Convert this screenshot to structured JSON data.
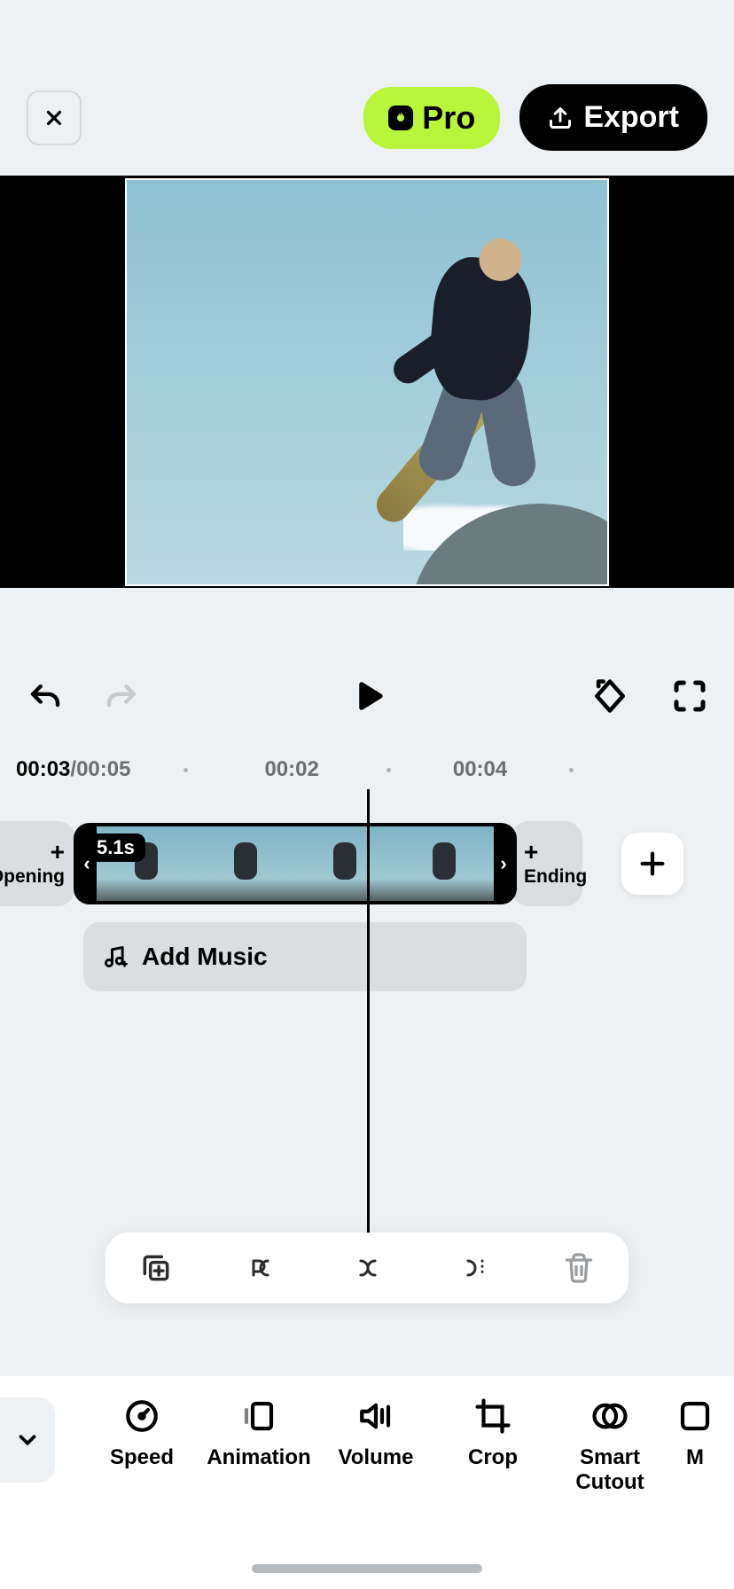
{
  "header": {
    "pro_label": "Pro",
    "export_label": "Export"
  },
  "transport": {},
  "ruler": {
    "current": "00:03",
    "total": "00:05",
    "tick1": "00:02",
    "tick2": "00:04"
  },
  "clip": {
    "opening_label": "Opening",
    "ending_label": "Ending",
    "duration": "5.1s"
  },
  "music": {
    "label": "Add Music"
  },
  "toolbar": {
    "items": [
      {
        "id": "speed",
        "label": "Speed"
      },
      {
        "id": "animation",
        "label": "Animation"
      },
      {
        "id": "volume",
        "label": "Volume"
      },
      {
        "id": "crop",
        "label": "Crop"
      },
      {
        "id": "smart-cutout",
        "label": "Smart\nCutout"
      },
      {
        "id": "more",
        "label": "M"
      }
    ]
  }
}
